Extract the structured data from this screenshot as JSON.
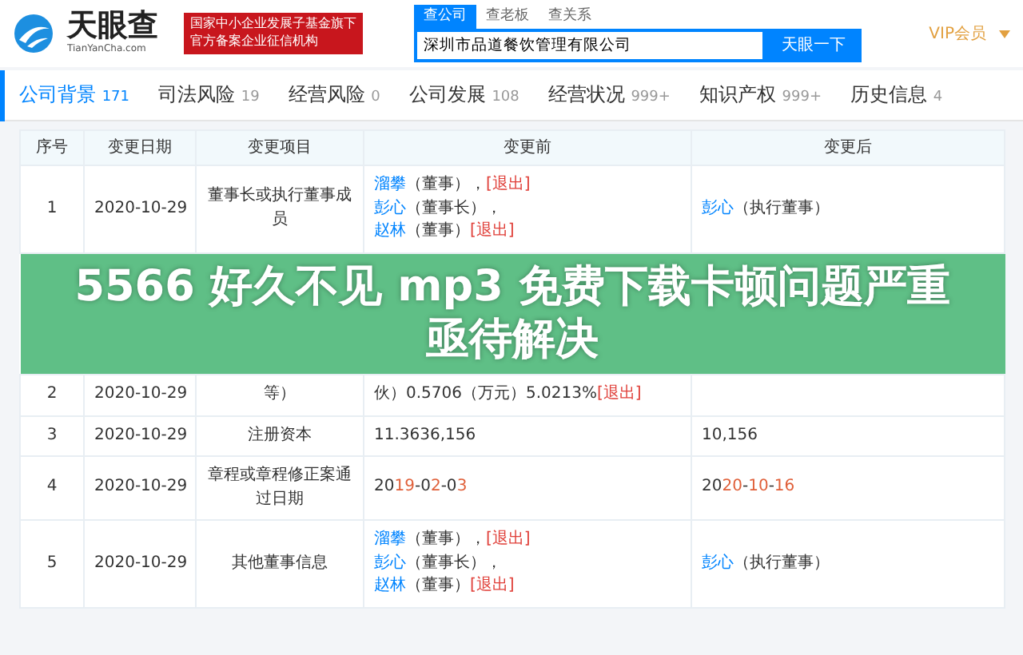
{
  "header": {
    "logo_text": "天眼查",
    "logo_sub": "TianYanCha.com",
    "badge_lines": [
      "国家中小企业发展子基金旗下",
      "官方备案企业征信机构"
    ],
    "search_tabs": [
      {
        "label": "查公司",
        "selected": true
      },
      {
        "label": "查老板",
        "selected": false
      },
      {
        "label": "查关系",
        "selected": false
      }
    ],
    "search_value": "深圳市品道餐饮管理有限公司",
    "search_button": "天眼一下",
    "vip": "VIP会员"
  },
  "nav_tabs": [
    {
      "label": "公司背景",
      "count": "171",
      "selected": true
    },
    {
      "label": "司法风险",
      "count": "19",
      "selected": false
    },
    {
      "label": "经营风险",
      "count": "0",
      "selected": false
    },
    {
      "label": "公司发展",
      "count": "108",
      "selected": false
    },
    {
      "label": "经营状况",
      "count": "999+",
      "selected": false
    },
    {
      "label": "知识产权",
      "count": "999+",
      "selected": false
    },
    {
      "label": "历史信息",
      "count": "4",
      "selected": false
    }
  ],
  "table": {
    "columns": [
      "序号",
      "变更日期",
      "变更项目",
      "变更前",
      "变更后"
    ],
    "rows": [
      {
        "index": "1",
        "date": "2020-10-29",
        "item": "董事长或执行董事成员",
        "before": [
          [
            {
              "kind": "person",
              "text": "溜攀"
            },
            {
              "kind": "plain",
              "text": "（董事），"
            },
            {
              "kind": "exit",
              "text": "[退出]"
            }
          ],
          [
            {
              "kind": "person",
              "text": "彭心"
            },
            {
              "kind": "plain",
              "text": "（董事长），"
            }
          ],
          [
            {
              "kind": "person",
              "text": "赵林"
            },
            {
              "kind": "plain",
              "text": "（董事）"
            },
            {
              "kind": "exit",
              "text": "[退出]"
            }
          ]
        ],
        "after": [
          [
            {
              "kind": "person",
              "text": "彭心"
            },
            {
              "kind": "plain",
              "text": "（执行董事）"
            }
          ]
        ]
      },
      {
        "index": "2",
        "date": "2020-10-29",
        "item": "等）",
        "before": [
          [
            {
              "kind": "plain",
              "text": "伙）0.5706（万元）5.0213%"
            },
            {
              "kind": "exit",
              "text": "[退出]"
            }
          ]
        ],
        "after": []
      },
      {
        "index": "3",
        "date": "2020-10-29",
        "item": "注册资本",
        "before": [
          [
            {
              "kind": "plain",
              "text": "11.3636,156"
            }
          ]
        ],
        "after": [
          [
            {
              "kind": "plain",
              "text": "10,156"
            }
          ]
        ]
      },
      {
        "index": "4",
        "date": "2020-10-29",
        "item": "章程或章程修正案通过日期",
        "before": [
          [
            {
              "kind": "plain",
              "text": "20"
            },
            {
              "kind": "diff",
              "text": "19"
            },
            {
              "kind": "plain",
              "text": "-0"
            },
            {
              "kind": "diff",
              "text": "2"
            },
            {
              "kind": "plain",
              "text": "-0"
            },
            {
              "kind": "diff",
              "text": "3"
            }
          ]
        ],
        "after": [
          [
            {
              "kind": "plain",
              "text": "20"
            },
            {
              "kind": "diff",
              "text": "20"
            },
            {
              "kind": "plain",
              "text": "-"
            },
            {
              "kind": "diff",
              "text": "10"
            },
            {
              "kind": "plain",
              "text": "-"
            },
            {
              "kind": "diff",
              "text": "16"
            }
          ]
        ]
      },
      {
        "index": "5",
        "date": "2020-10-29",
        "item": "其他董事信息",
        "before": [
          [
            {
              "kind": "person",
              "text": "溜攀"
            },
            {
              "kind": "plain",
              "text": "（董事），"
            },
            {
              "kind": "exit",
              "text": "[退出]"
            }
          ],
          [
            {
              "kind": "person",
              "text": "彭心"
            },
            {
              "kind": "plain",
              "text": "（董事长），"
            }
          ],
          [
            {
              "kind": "person",
              "text": "赵林"
            },
            {
              "kind": "plain",
              "text": "（董事）"
            },
            {
              "kind": "exit",
              "text": "[退出]"
            }
          ]
        ],
        "after": [
          [
            {
              "kind": "person",
              "text": "彭心"
            },
            {
              "kind": "plain",
              "text": "（执行董事）"
            }
          ]
        ]
      }
    ]
  },
  "banner": {
    "text": "5566 好久不见 mp3 免费下载卡顿问题严重亟待解决"
  }
}
